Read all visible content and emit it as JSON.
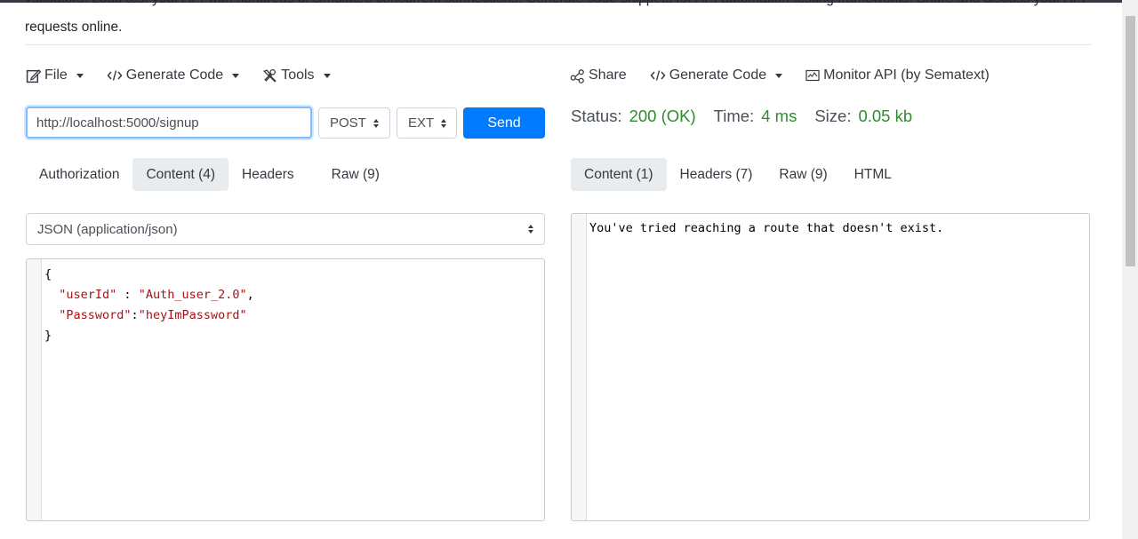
{
  "description": {
    "line1": "validators. Load test your API with hundreds of simulated concurrent connections. Generate code snippets for API automation testing frameworks. Share and discuss your API",
    "line2": "requests online."
  },
  "left_menu": {
    "file": "File",
    "generate_code": "Generate Code",
    "tools": "Tools"
  },
  "right_menu": {
    "share": "Share",
    "generate_code": "Generate Code",
    "monitor": "Monitor API (by Sematext)"
  },
  "request": {
    "url": "http://localhost:5000/signup",
    "method": "POST",
    "ext": "EXT",
    "send_label": "Send"
  },
  "response_status": {
    "status_label": "Status:",
    "status_value": "200 (OK)",
    "time_label": "Time:",
    "time_value": "4 ms",
    "size_label": "Size:",
    "size_value": "0.05 kb"
  },
  "request_tabs": [
    {
      "label": "Authorization",
      "active": false
    },
    {
      "label": "Content (4)",
      "active": true
    },
    {
      "label": "Headers",
      "active": false
    },
    {
      "label": "Raw (9)",
      "active": false
    }
  ],
  "response_tabs": [
    {
      "label": "Content (1)",
      "active": true
    },
    {
      "label": "Headers (7)",
      "active": false
    },
    {
      "label": "Raw (9)",
      "active": false
    },
    {
      "label": "HTML",
      "active": false
    }
  ],
  "content_type": "JSON (application/json)",
  "request_body": {
    "open": "{",
    "key1": "\"userId\"",
    "sep1": " : ",
    "val1": "\"Auth_user_2.0\"",
    "end1": ",",
    "key2": "\"Password\"",
    "sep2": ":",
    "val2": "\"heyImPassword\"",
    "close": "}"
  },
  "response_body": "You've tried reaching a route that doesn't exist.",
  "colors": {
    "accent": "#007bff",
    "status_ok": "#2e8b2e",
    "json_string": "#a31515"
  }
}
